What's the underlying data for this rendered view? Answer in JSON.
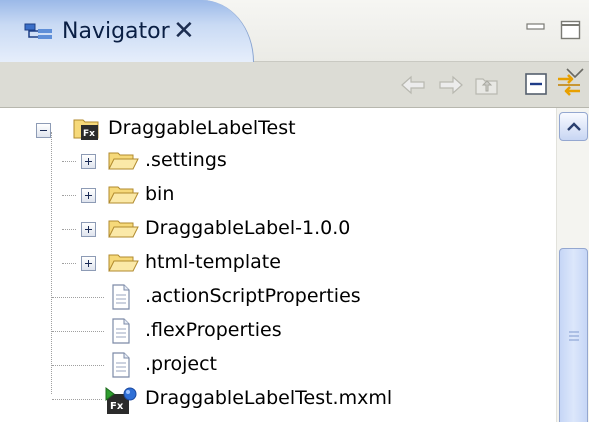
{
  "view": {
    "title": "Navigator",
    "close_glyph": "✕",
    "icon": "navigator-view-icon"
  },
  "toolbar": {
    "buttons": [
      {
        "name": "back",
        "icon": "arrow-left-icon",
        "enabled": false
      },
      {
        "name": "forward",
        "icon": "arrow-right-icon",
        "enabled": false
      },
      {
        "name": "up",
        "icon": "go-up-folder-icon",
        "enabled": false
      },
      {
        "name": "collapse-all",
        "icon": "collapse-all-icon",
        "enabled": true
      },
      {
        "name": "link-with-editor",
        "icon": "link-with-editor-icon",
        "enabled": true
      }
    ]
  },
  "tree": {
    "project": {
      "label": "DraggableLabelTest",
      "icon": "flex-project-icon",
      "expanded": true
    },
    "items": [
      {
        "label": ".settings",
        "type": "folder",
        "expandable": true
      },
      {
        "label": "bin",
        "type": "folder",
        "expandable": true
      },
      {
        "label": "DraggableLabel-1.0.0",
        "type": "folder",
        "expandable": true
      },
      {
        "label": "html-template",
        "type": "folder",
        "expandable": true
      },
      {
        "label": ".actionScriptProperties",
        "type": "file",
        "expandable": false
      },
      {
        "label": ".flexProperties",
        "type": "file",
        "expandable": false
      },
      {
        "label": ".project",
        "type": "file",
        "expandable": false
      },
      {
        "label": "DraggableLabelTest.mxml",
        "type": "mxml-application",
        "expandable": false
      }
    ]
  },
  "colors": {
    "tab_active": "#c9daf4",
    "toolbar_bg": "#dcdcd5",
    "folder_fill": "#f6d97a",
    "folder_stroke": "#b08a2e",
    "link_icon": "#e8a000"
  }
}
